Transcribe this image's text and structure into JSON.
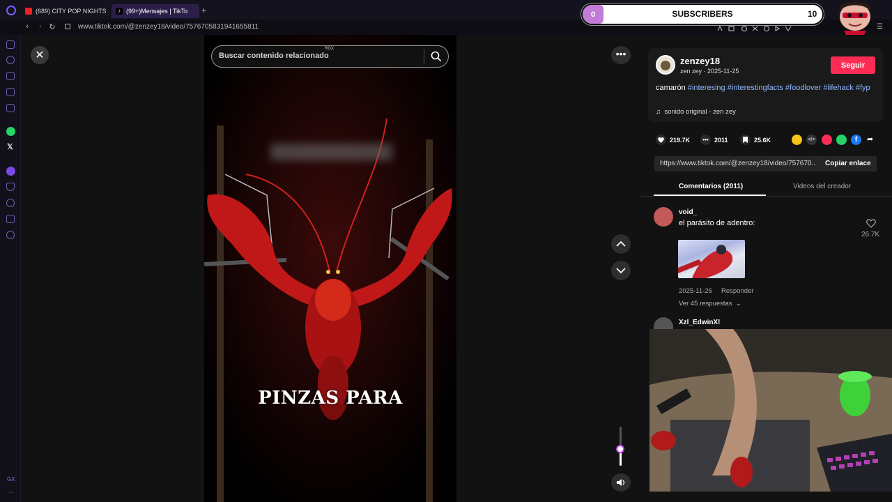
{
  "browser": {
    "tabs": [
      {
        "label": "(689) CITY POP NIGHTS –",
        "active": false,
        "icon": "youtube-icon"
      },
      {
        "label": "(99+)Mensajes | TikTo",
        "active": true,
        "icon": "tiktok-icon"
      }
    ],
    "url": "www.tiktok.com/@zenzey18/video/7576705831941655811"
  },
  "stream_overlay": {
    "current": "0",
    "label": "SUBSCRIBERS",
    "goal": "10"
  },
  "search": {
    "placeholder": "Buscar contenido relacionado",
    "tag": "RGX"
  },
  "video": {
    "caption": "PINZAS PARA"
  },
  "post": {
    "author": "zenzey18",
    "author_sub": "zen zey · 2025-11-25",
    "follow_label": "Seguir",
    "description_prefix": "camarón ",
    "hashtags": [
      "#interesing",
      "#interestingfacts",
      "#foodlover",
      "#lifehack",
      "#fyp"
    ],
    "sound": "sonido original - zen zey",
    "likes": "219.7K",
    "comments": "2011",
    "saves": "25.6K",
    "link": "https://www.tiktok.com/@zenzey18/video/757670...",
    "copy_label": "Copiar enlace"
  },
  "tabs": {
    "comments": "Comentarios (2011)",
    "creator_videos": "Videos del creador"
  },
  "comments": [
    {
      "user": "void_",
      "text": "el parásito de adentro:",
      "likes": "26.7K",
      "date": "2025-11-26",
      "reply_label": "Responder",
      "more_replies": "Ver 45 respuestas"
    },
    {
      "user": "Xzl_EdwinX!"
    }
  ],
  "colors": {
    "follow": "#fe2c55",
    "hashtag": "#8fb7ff",
    "accent": "#c23be8"
  }
}
